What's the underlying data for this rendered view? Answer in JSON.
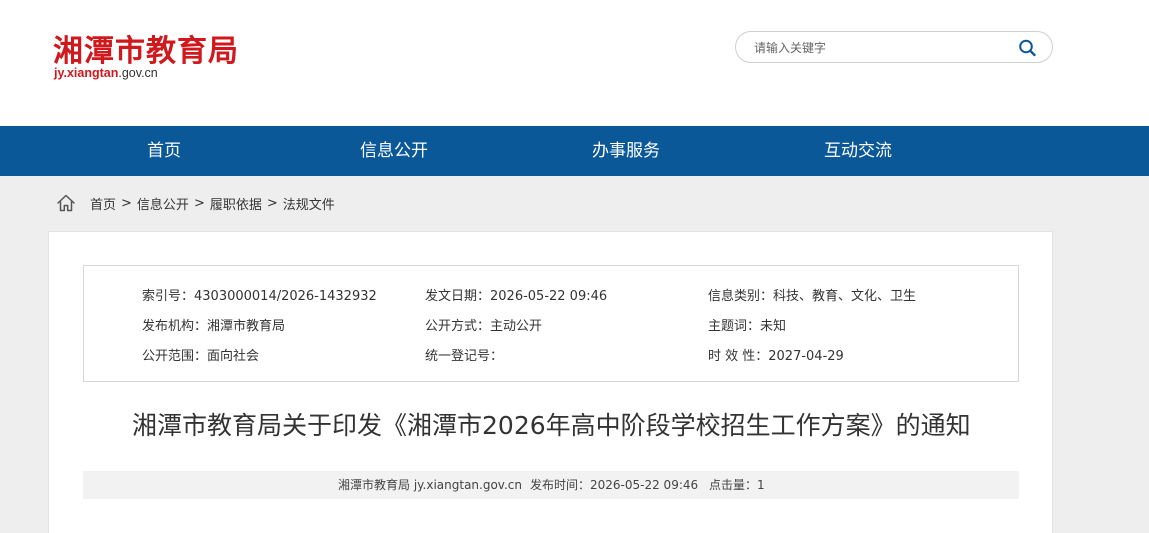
{
  "header": {
    "site_title": "湘潭市教育局",
    "url_red": "jy.xiangtan",
    "url_rest": ".gov.cn"
  },
  "search": {
    "placeholder": "请输入关键字",
    "icon": "search-icon"
  },
  "nav": {
    "items": [
      {
        "label": "首页"
      },
      {
        "label": "信息公开"
      },
      {
        "label": "办事服务"
      },
      {
        "label": "互动交流"
      }
    ]
  },
  "breadcrumb": {
    "icon": "home-icon",
    "items": [
      "首页",
      "信息公开",
      "履职依据",
      "法规文件"
    ],
    "separator": ">"
  },
  "meta": {
    "index_no": "索引号：4303000014/2026-1432932",
    "publish_date": "发文日期：2026-05-22 09:46",
    "category": "信息类别：科技、教育、文化、卫生",
    "issuer": "发布机构：湘潭市教育局",
    "public_mode": "公开方式：主动公开",
    "subject": "主题词：未知",
    "scope": "公开范围：面向社会",
    "register_no": "统一登记号：",
    "validity": "时 效 性：2027-04-29"
  },
  "document": {
    "title": "湘潭市教育局关于印发《湘潭市2026年高中阶段学校招生工作方案》的通知"
  },
  "info_bar": {
    "source": "湘潭市教育局 jy.xiangtan.gov.cn",
    "time": "发布时间：2026-05-22 09:46",
    "hits": "点击量：1"
  },
  "colors": {
    "brand_red": "#d0181d",
    "nav_blue": "#0b5899",
    "band_gray": "#eeeeee"
  }
}
